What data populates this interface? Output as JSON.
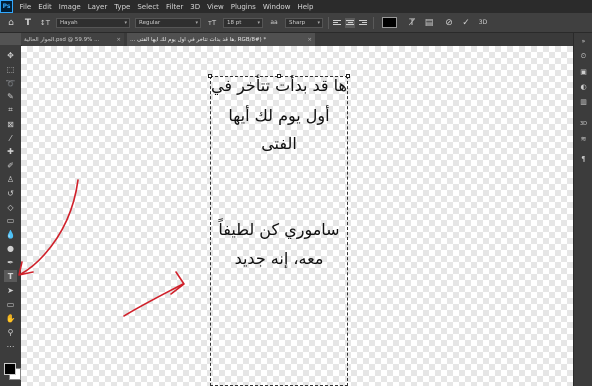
{
  "menubar": {
    "logo": "Ps",
    "items": [
      "File",
      "Edit",
      "Image",
      "Layer",
      "Type",
      "Select",
      "Filter",
      "3D",
      "View",
      "Plugins",
      "Window",
      "Help"
    ]
  },
  "options": {
    "font_family": "Hayah",
    "font_style": "Regular",
    "font_size": "18 pt",
    "antialias": "Sharp",
    "text_color": "#000000"
  },
  "tabs": [
    {
      "label": "الجوار الحالية.psd @ 59.9% ...",
      "close": "×"
    },
    {
      "label": "... ها قد بدأت تتأخر في أول يوم لك أيها الفتى, RGB/8#) *",
      "close": "×"
    }
  ],
  "canvas_text": {
    "line1": "ها قد بدأت تتأخر في",
    "line2": "أول يوم لك أيها",
    "line3": "الفتى",
    "line4": "ساموري كن لطيفاً",
    "line5": "معه، إنه جديد"
  },
  "tools": [
    "move-icon",
    "marquee-icon",
    "lasso-icon",
    "quick-select-icon",
    "crop-icon",
    "frame-icon",
    "eyedropper-icon",
    "healing-icon",
    "brush-icon",
    "clone-stamp-icon",
    "history-brush-icon",
    "eraser-icon",
    "gradient-icon",
    "blur-icon",
    "dodge-icon",
    "pen-icon",
    "type-icon",
    "path-select-icon",
    "rectangle-icon",
    "hand-icon",
    "zoom-icon",
    "more-icon"
  ],
  "colors": {
    "foreground": "#000000",
    "background": "#ffffff",
    "annotation": "#d0202a"
  }
}
